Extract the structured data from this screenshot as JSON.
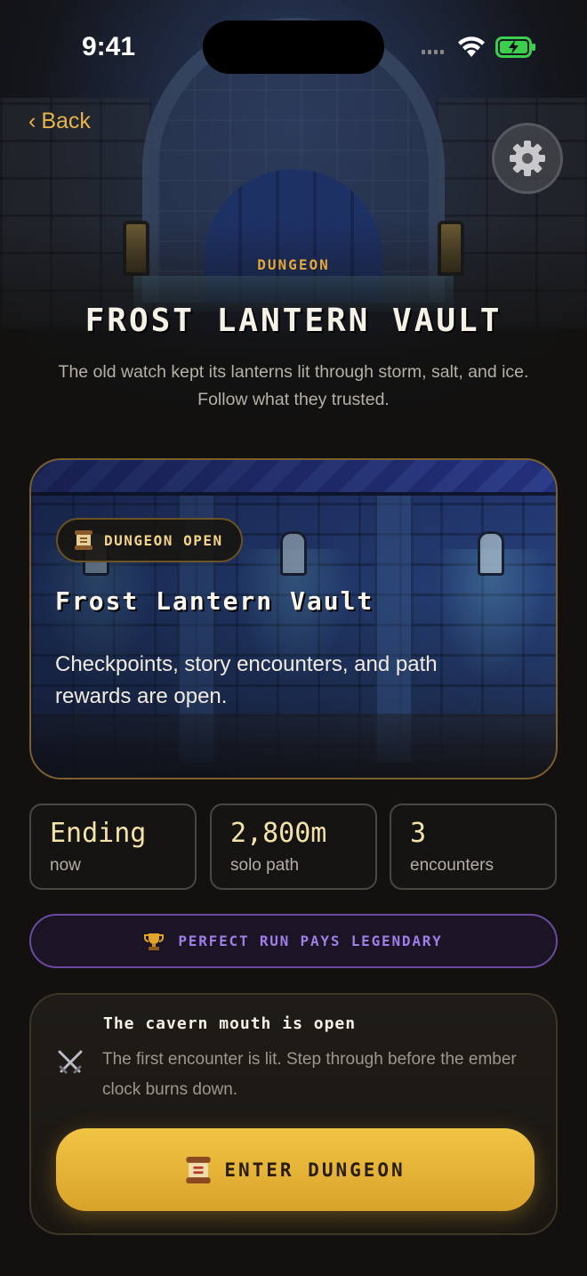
{
  "status_bar": {
    "time": "9:41"
  },
  "nav": {
    "back_label": "Back",
    "back_chevron": "‹",
    "settings_icon": "gear-icon"
  },
  "header": {
    "eyebrow": "DUNGEON",
    "title": "FROST LANTERN VAULT",
    "subtitle_line1": "The old watch kept its lanterns lit through storm, salt, and ice.",
    "subtitle_line2": "Follow what they trusted."
  },
  "card": {
    "badge_icon": "scroll-icon",
    "badge_label": "DUNGEON OPEN",
    "title": "Frost Lantern Vault",
    "description": "Checkpoints, story encounters, and path rewards are open."
  },
  "stats": [
    {
      "value": "Ending",
      "label": "now"
    },
    {
      "value": "2,800m",
      "label": "solo path"
    },
    {
      "value": "3",
      "label": "encounters"
    }
  ],
  "perfect_run": {
    "icon": "trophy-icon",
    "label": "PERFECT RUN PAYS LEGENDARY"
  },
  "encounter": {
    "icon": "crossed-swords-icon",
    "title": "The cavern mouth is open",
    "description": "The first encounter is lit. Step through before the ember clock burns down.",
    "cta_icon": "scroll-icon",
    "cta_label": "ENTER DUNGEON"
  },
  "colors": {
    "accent_gold": "#e7b34a",
    "button_gold": "#f1c445",
    "purple": "#a07ee8",
    "background": "#121110"
  }
}
